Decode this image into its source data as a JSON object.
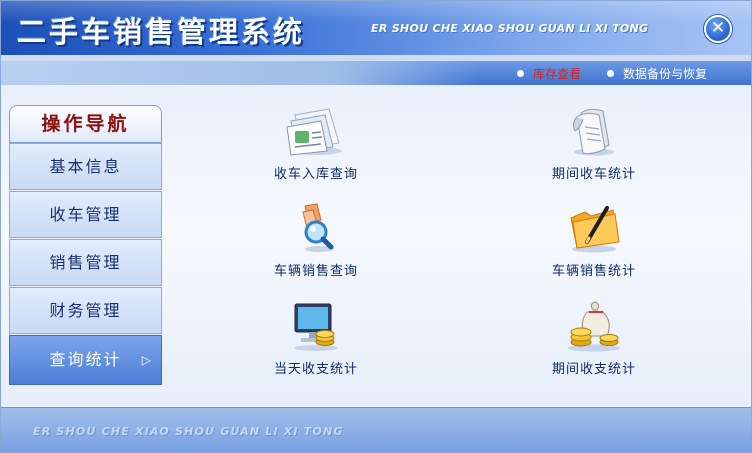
{
  "app": {
    "title": "二手车销售管理系统",
    "subtitle": "ER SHOU CHE XIAO SHOU GUAN LI XI TONG",
    "close_icon": "close-icon"
  },
  "quickbar": {
    "stock_label": "库存查看",
    "backup_label": "数据备份与恢复",
    "active_color": "#d8221c"
  },
  "sidebar": {
    "title": "操作导航",
    "items": [
      {
        "label": "基本信息"
      },
      {
        "label": "收车管理"
      },
      {
        "label": "销售管理"
      },
      {
        "label": "财务管理"
      },
      {
        "label": "查询统计",
        "active": true,
        "icon": "triangle-right-icon"
      }
    ]
  },
  "tiles": [
    {
      "label": "收车入库查询",
      "icon": "document-stack-icon"
    },
    {
      "label": "期间收车统计",
      "icon": "scroll-icon"
    },
    {
      "label": "车辆销售查询",
      "icon": "magnifier-icon"
    },
    {
      "label": "车辆销售统计",
      "icon": "folder-pen-icon"
    },
    {
      "label": "当天收支统计",
      "icon": "monitor-coins-icon"
    },
    {
      "label": "期间收支统计",
      "icon": "coins-bag-icon"
    }
  ],
  "footer": {
    "text": "ER SHOU CHE XIAO SHOU GUAN LI XI TONG"
  },
  "colors": {
    "header_dark": "#1d4fb8",
    "header_light": "#a7c4f4",
    "nav_text": "#1b2f6e",
    "sidebar_title": "#8a1010",
    "tile_label": "#102a6b"
  }
}
